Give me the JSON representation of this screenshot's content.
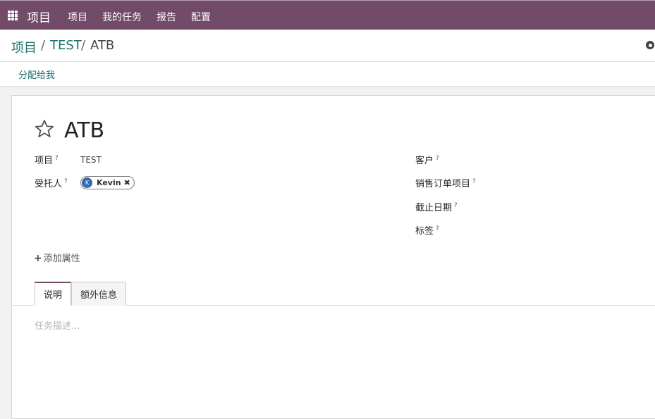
{
  "topbar": {
    "app_name": "项目",
    "menu": [
      "项目",
      "我的任务",
      "报告",
      "配置"
    ]
  },
  "breadcrumb": {
    "items": [
      "项目",
      "TEST",
      "ATB"
    ],
    "separator": "/"
  },
  "status": {
    "assign_label": "分配给我"
  },
  "task": {
    "title": "ATB",
    "project_label": "项目",
    "project_value": "TEST",
    "assignee_label": "受托人",
    "assignee_initial": "K",
    "assignee_name": "Kevin",
    "tag_remove": "✖",
    "customer_label": "客户",
    "sale_line_label": "销售订单项目",
    "deadline_label": "截止日期",
    "tags_label": "标签",
    "help": "?",
    "add_property": "添加属性"
  },
  "tabs": [
    "说明",
    "额外信息"
  ],
  "description_placeholder": "任务描述...",
  "colors": {
    "brand": "#714b67",
    "link": "#1f6f72",
    "avatar": "#3468b2"
  }
}
